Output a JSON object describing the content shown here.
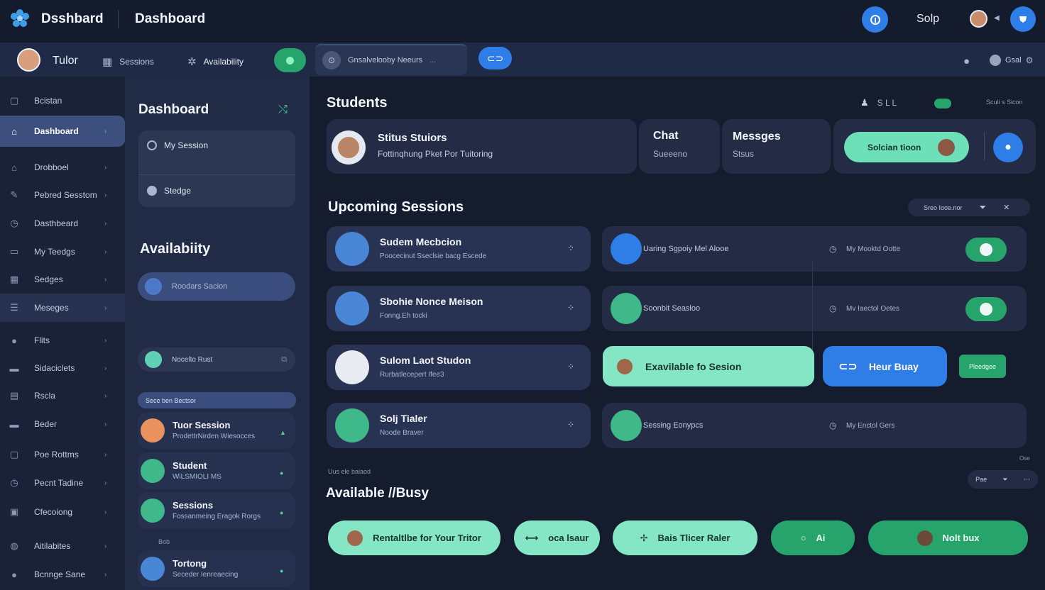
{
  "header": {
    "app_title": "Dsshbard",
    "page_title": "Dashboard",
    "user_name": "Solp",
    "icons": [
      "flower-logo-icon",
      "help-icon",
      "avatar",
      "caret-down-icon",
      "shield-icon"
    ]
  },
  "navbar": {
    "name": "Tulor",
    "tabs": [
      {
        "label": "Sessions",
        "icon": "grid-icon"
      },
      {
        "label": "Availability",
        "icon": "gear-icon"
      }
    ],
    "search_text": "Gnsalvelooby Neeurs",
    "search_suffix": "...",
    "right_label": "Gsal"
  },
  "sidebar": {
    "items": [
      {
        "label": "Bcistan",
        "icon": "square-icon"
      },
      {
        "label": "Dashboard",
        "icon": "home-icon",
        "active": true
      },
      {
        "label": "Drobboel",
        "icon": "home-icon"
      },
      {
        "label": "Pebred Sesstom",
        "icon": "pen-icon"
      },
      {
        "label": "Dasthbeard",
        "icon": "clock-icon"
      },
      {
        "label": "My Teedgs",
        "icon": "chat-icon"
      },
      {
        "label": "Sedges",
        "icon": "grid-icon"
      },
      {
        "label": "Meseges",
        "icon": "mail-icon",
        "highlight": true
      },
      {
        "label": "Flits",
        "icon": "user-icon"
      },
      {
        "label": "Sidaciclets",
        "icon": "card-icon"
      },
      {
        "label": "Rscla",
        "icon": "doc-icon"
      },
      {
        "label": "Beder",
        "icon": "card-icon"
      },
      {
        "label": "Poe Rottms",
        "icon": "square-icon"
      },
      {
        "label": "Pecnt Tadine",
        "icon": "clock-icon"
      },
      {
        "label": "Cfecoiong",
        "icon": "image-icon"
      },
      {
        "label": "Aitilabites",
        "icon": "globe-icon"
      },
      {
        "label": "Bcnnge Sane",
        "icon": "user-icon"
      }
    ]
  },
  "middle": {
    "title": "Dashboard",
    "card_rows": [
      "My Session",
      "Stedge"
    ],
    "availability_title": "Availabiity",
    "availability_placeholder": "Roodars Sacion",
    "notice_label": "Nocelto Rust",
    "filter_label": "Sece ben Bectsor",
    "list": [
      {
        "title": "Tuor Session",
        "sub": "ProdettrNirden Wiesocces",
        "color": "#e9925d"
      },
      {
        "title": "Student",
        "sub": "WiLSMIOLI MS",
        "color": "#3fb98a"
      },
      {
        "title": "Sessions",
        "sub": "Fossanmeing Eragok Rorgs",
        "color": "#3fb98a"
      }
    ],
    "list_divider": "Bob",
    "last_item": {
      "title": "Tortong",
      "sub": "Seceder Ienreaecing",
      "color": "#4a86d6"
    }
  },
  "students": {
    "title": "Students",
    "toolbar_text": "S L L",
    "toolbar_right": "Sculi s Sicon",
    "status_title": "Stitus Stuiors",
    "status_sub": "Fottinqhung Pket Por Tuitoring",
    "chat_title": "Chat",
    "chat_sub": "Sueeeno",
    "messages_title": "Messges",
    "messages_sub": "Stsus",
    "solution_label": "Solcian tioon"
  },
  "upcoming": {
    "title": "Upcoming Sessions",
    "filter": "Sreo Iooe.nor",
    "sessions": [
      {
        "name": "Sudem Mecbcion",
        "sub": "Poocecinut Sseclsie bacg Escede",
        "color": "#4a86d6"
      },
      {
        "name": "Sbohie Nonce Meison",
        "sub": "Fonng.Eh tocki",
        "color": "#4a86d6"
      },
      {
        "name": "Sulom Laot Studon",
        "sub": "Rurbatlecepert Ifee3",
        "color": "#e8ebf1"
      },
      {
        "name": "Solj Tialer",
        "sub": "Noode Braver",
        "color": "#3fb98a"
      }
    ],
    "details": [
      {
        "title": "Uaring Sgpoiy Mel Alooe",
        "label": "My  Mooktd Ootte",
        "color": "#2f7de6"
      },
      {
        "title": "Soonbit Seasloo",
        "label": "Mv  Iaectol Oetes",
        "color": "#3fb98a"
      },
      {
        "title": "Sessing Eonypcs",
        "label": "My  Enctol Gers",
        "color": "#3fb98a"
      }
    ],
    "available_label": "Exavilable fo Sesion",
    "busy_label": "Heur Buay",
    "small_label": "Pleedgee"
  },
  "bottom": {
    "meta_left": "Uus  ele  baiaod",
    "meta_right": "Ose",
    "filter": "Pae",
    "title": "Available //Busy",
    "pills": [
      {
        "label": "Rentaltlbe for Your Tritor",
        "style": "mint"
      },
      {
        "label": "oca lsaur",
        "style": "mint"
      },
      {
        "label": "Bais Tlicer Raler",
        "style": "mint"
      },
      {
        "label": "Ai",
        "style": "green"
      },
      {
        "label": "Nolt bux",
        "style": "green"
      }
    ]
  },
  "colors": {
    "accent_blue": "#2f7de6",
    "accent_green": "#27a46b",
    "mint": "#84e6c4",
    "bg": "#151c2d"
  }
}
